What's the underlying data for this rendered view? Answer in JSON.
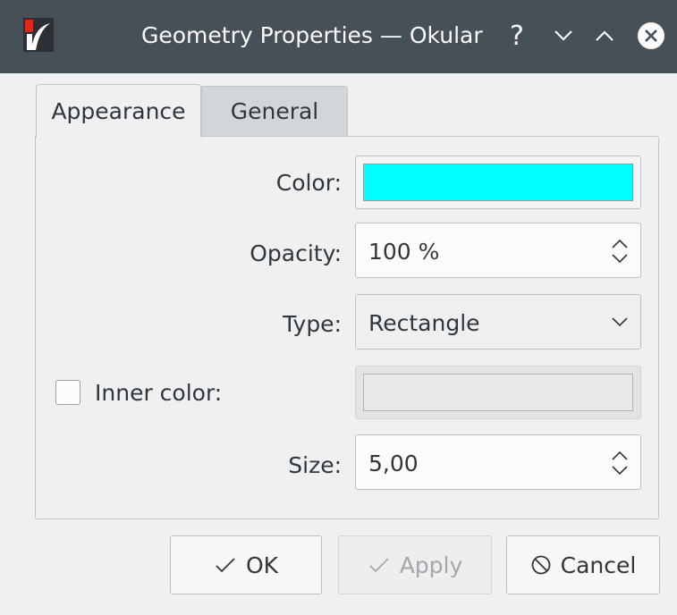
{
  "window": {
    "title": "Geometry Properties — Okular",
    "help_glyph": "?"
  },
  "tabs": [
    {
      "label": "Appearance",
      "active": true
    },
    {
      "label": "General",
      "active": false
    }
  ],
  "form": {
    "color_label": "Color:",
    "color_value": "#00ffff",
    "opacity_label": "Opacity:",
    "opacity_value": "100 %",
    "type_label": "Type:",
    "type_value": "Rectangle",
    "inner_color_label": "Inner color:",
    "inner_color_checked": false,
    "size_label": "Size:",
    "size_value": "5,00"
  },
  "buttons": {
    "ok": "OK",
    "apply": "Apply",
    "cancel": "Cancel"
  },
  "colors": {
    "titlebar": "#475057",
    "window_bg": "#eff0f1",
    "accent_swatch": "#00ffff"
  }
}
